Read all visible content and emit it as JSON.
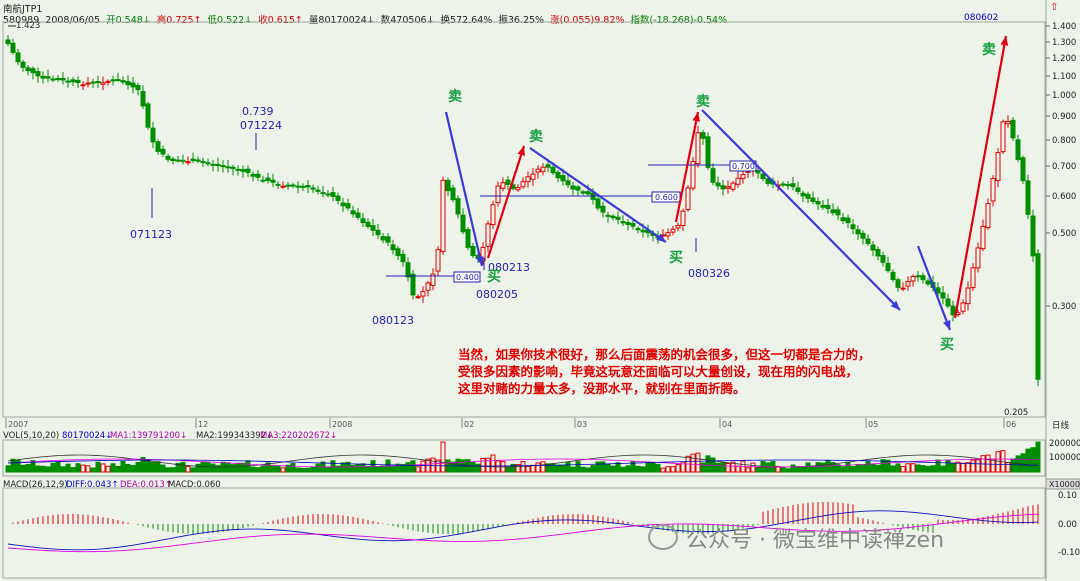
{
  "header": {
    "title": "南航JTP1",
    "code": "580989",
    "date": "2008/06/05",
    "open": "开0.548↓",
    "high": "高0.725↑",
    "low": "低0.522↓",
    "close": "收0.615↑",
    "volume": "量80170024↓",
    "amount": "数470506↓",
    "turnover": "换572.64%",
    "amplitude": "振36.25%",
    "change": "涨(0.055)9.82%",
    "index": "指数(-18.268)-0.54%"
  },
  "top_right_label": "080602",
  "corner_labels": {
    "high": "1.423",
    "low": "0.205"
  },
  "price_axis": [
    "1.400",
    "1.300",
    "1.200",
    "1.100",
    "1.000",
    "0.900",
    "0.800",
    "0.700",
    "0.600",
    "0.500",
    "0.300"
  ],
  "time_axis": [
    "2007",
    "12",
    "2008",
    "02",
    "03",
    "04",
    "05",
    "06"
  ],
  "time_axis_right": "日线",
  "date_labels": {
    "071123": "071123",
    "071224": "071224",
    "p0739": "0.739",
    "080123": "080123",
    "080205": "080205",
    "080213": "080213",
    "080326": "080326"
  },
  "price_boxes": [
    "0.400",
    "0.600",
    "0.700"
  ],
  "signals": {
    "sell": "卖",
    "buy": "买"
  },
  "annotation": [
    "当然，如果你技术很好，那么后面震荡的机会很多，但这一切都是合力的，",
    "受很多因素的影响，毕竟这玩意还面临可以大量创设，现在用的闪电战，",
    "这里对赌的力量太多，没那水平，就别在里面折腾。"
  ],
  "vol_panel": {
    "title": "VOL(5,10,20)",
    "value": "80170024↓",
    "ma1": "MA1:139791200↓",
    "ma2": "MA2:199343392↓",
    "ma3": "MA3:220202672↓",
    "axis": [
      "200000",
      "100000"
    ],
    "unit": "X10000"
  },
  "macd_panel": {
    "title": "MACD(26,12,9)",
    "diff": "DIFF:0.043↑",
    "dea": "DEA:0.013↑",
    "macd": "MACD:0.060",
    "axis": [
      "0.10",
      "0.00",
      "-0.10"
    ]
  },
  "watermark": "公众号 · 微宝维中读禅zen",
  "colors": {
    "up": "#e00000",
    "down": "#008f00",
    "bg": "#eef3ea",
    "arrow_red": "#e00010",
    "arrow_blue": "#3a3ad8",
    "ma1": "#333333",
    "ma2": "#e000e0",
    "ma3": "#0000c0"
  }
}
